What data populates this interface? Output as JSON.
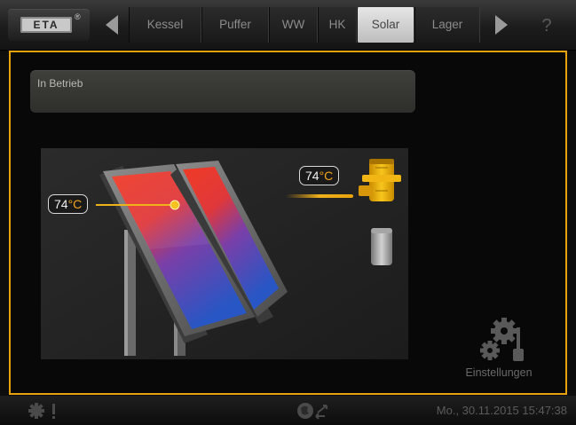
{
  "header": {
    "logo_text": "ETA",
    "logo_reg": "®",
    "tabs": [
      {
        "label": "Kessel",
        "active": false
      },
      {
        "label": "Puffer",
        "active": false
      },
      {
        "label": "WW",
        "active": false
      },
      {
        "label": "HK",
        "active": false
      },
      {
        "label": "Solar",
        "active": true
      },
      {
        "label": "Lager",
        "active": false
      }
    ],
    "help_label": "?"
  },
  "main": {
    "status": "In Betrieb",
    "collector_temp": {
      "value": "74",
      "unit": "°C"
    },
    "storage_temp": {
      "value": "74",
      "unit": "°C"
    },
    "settings_label": "Einstellungen"
  },
  "footer": {
    "datetime": "Mo., 30.11.2015 15:47:38"
  },
  "colors": {
    "accent": "#e8a30c",
    "collector_hot": "#e83b2a",
    "collector_cold": "#2a5fc8",
    "active_tab": "#d8d8d8"
  },
  "icons": {
    "left": "chevron-left-icon",
    "right": "chevron-right-icon",
    "help": "help-icon",
    "settings": "gears-icon",
    "warning": "warning-icon",
    "network": "network-icon"
  }
}
